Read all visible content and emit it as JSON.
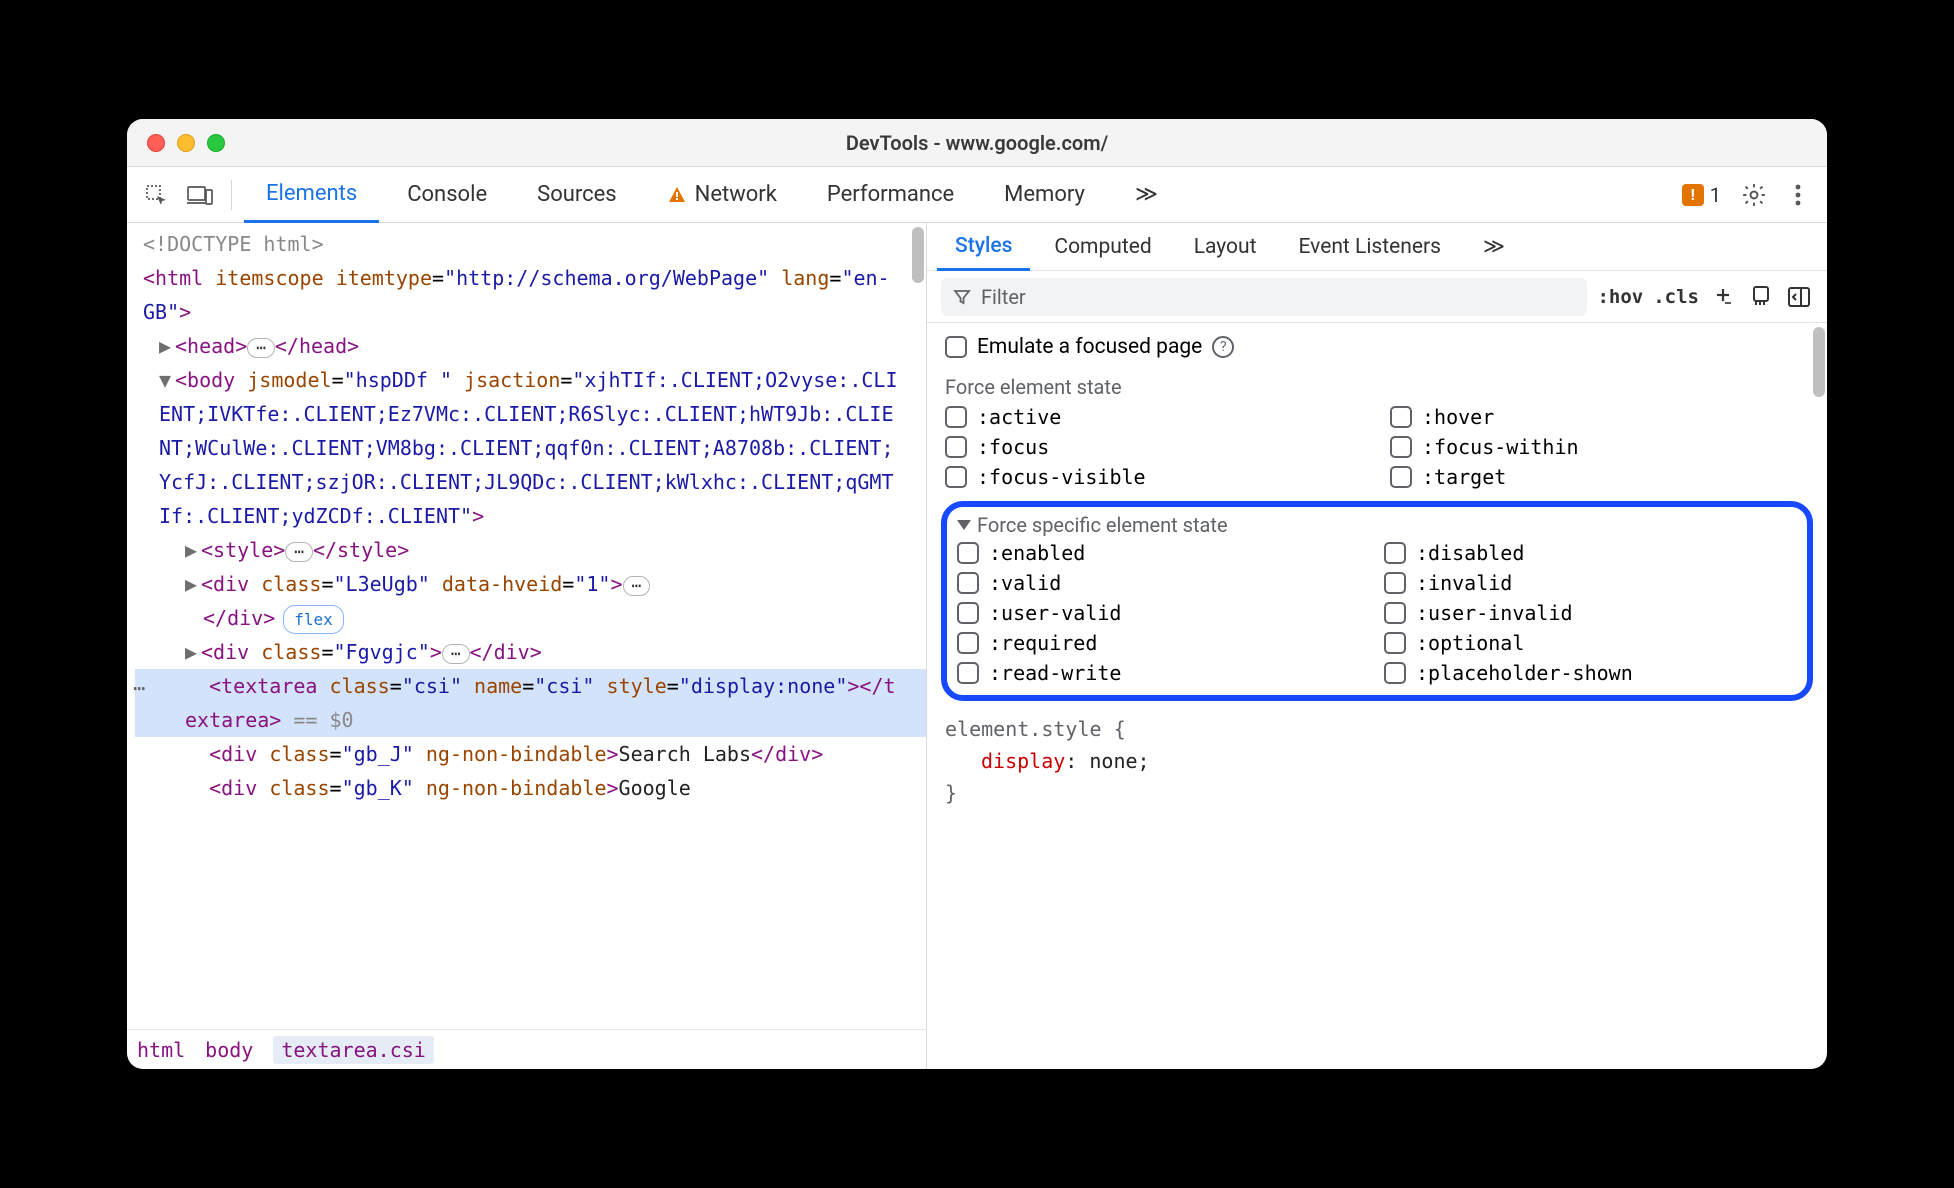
{
  "titlebar": {
    "title": "DevTools - www.google.com/"
  },
  "tabs": {
    "elements": "Elements",
    "console": "Console",
    "sources": "Sources",
    "network": "Network",
    "performance": "Performance",
    "memory": "Memory",
    "more": "≫"
  },
  "issues_count": "1",
  "dom": {
    "doctype": "<!DOCTYPE html>",
    "html_open": "<html itemscope itemtype=\"http://schema.org/WebPage\" lang=\"en-GB\">",
    "head": {
      "open": "<head>",
      "close": "</head>"
    },
    "body_open": "<body jsmodel=\"hspDDf \" jsaction=\"xjhTIf:.CLIENT;O2vyse:.CLIENT;IVKTfe:.CLIENT;Ez7VMc:.CLIENT;R6Slyc:.CLIENT;hWT9Jb:.CLIENT;WCulWe:.CLIENT;VM8bg:.CLIENT;qqf0n:.CLIENT;A8708b:.CLIENT;YcfJ:.CLIENT;szjOR:.CLIENT;JL9QDc:.CLIENT;kWlxhc:.CLIENT;qGMTIf:.CLIENT;ydZCDf:.CLIENT\">",
    "style": {
      "open": "<style>",
      "close": "</style>"
    },
    "div1": {
      "open": "<div class=\"L3eUgb\" data-hveid=\"1\">",
      "close": "</div>",
      "flex": "flex"
    },
    "div2": {
      "open": "<div class=\"Fgvgjc\">",
      "close": "</div>"
    },
    "textarea": {
      "line1": "<textarea class=\"csi\" name=\"csi\" style=\"di",
      "line2": "splay:none\"></textarea>",
      "eqzero": " == $0"
    },
    "div3": {
      "open": "<div class=\"gb_J\" ng-non-bindable>",
      "text": "Search Labs",
      "close": "</div>"
    },
    "div4": {
      "open": "<div class=\"gb_K\" ng-non-bindable>",
      "text": "Google"
    }
  },
  "breadcrumb": {
    "html": "html",
    "body": "body",
    "textarea": "textarea.csi"
  },
  "subtabs": {
    "styles": "Styles",
    "computed": "Computed",
    "layout": "Layout",
    "listeners": "Event Listeners",
    "more": "≫"
  },
  "styles_toolbar": {
    "filter_placeholder": "Filter",
    "hov": ":hov",
    "cls": ".cls"
  },
  "emulate": {
    "label": "Emulate a focused page"
  },
  "force_state_label": "Force element state",
  "force_states": {
    "active": ":active",
    "hover": ":hover",
    "focus": ":focus",
    "focus_within": ":focus-within",
    "focus_visible": ":focus-visible",
    "target": ":target"
  },
  "force_specific_label": "Force specific element state",
  "force_specific": {
    "enabled": ":enabled",
    "disabled": ":disabled",
    "valid": ":valid",
    "invalid": ":invalid",
    "user_valid": ":user-valid",
    "user_invalid": ":user-invalid",
    "required": ":required",
    "optional": ":optional",
    "read_write": ":read-write",
    "placeholder_shown": ":placeholder-shown"
  },
  "style_src": {
    "selector": "element.style {",
    "prop": "display",
    "val": ": none;",
    "close": "}"
  }
}
